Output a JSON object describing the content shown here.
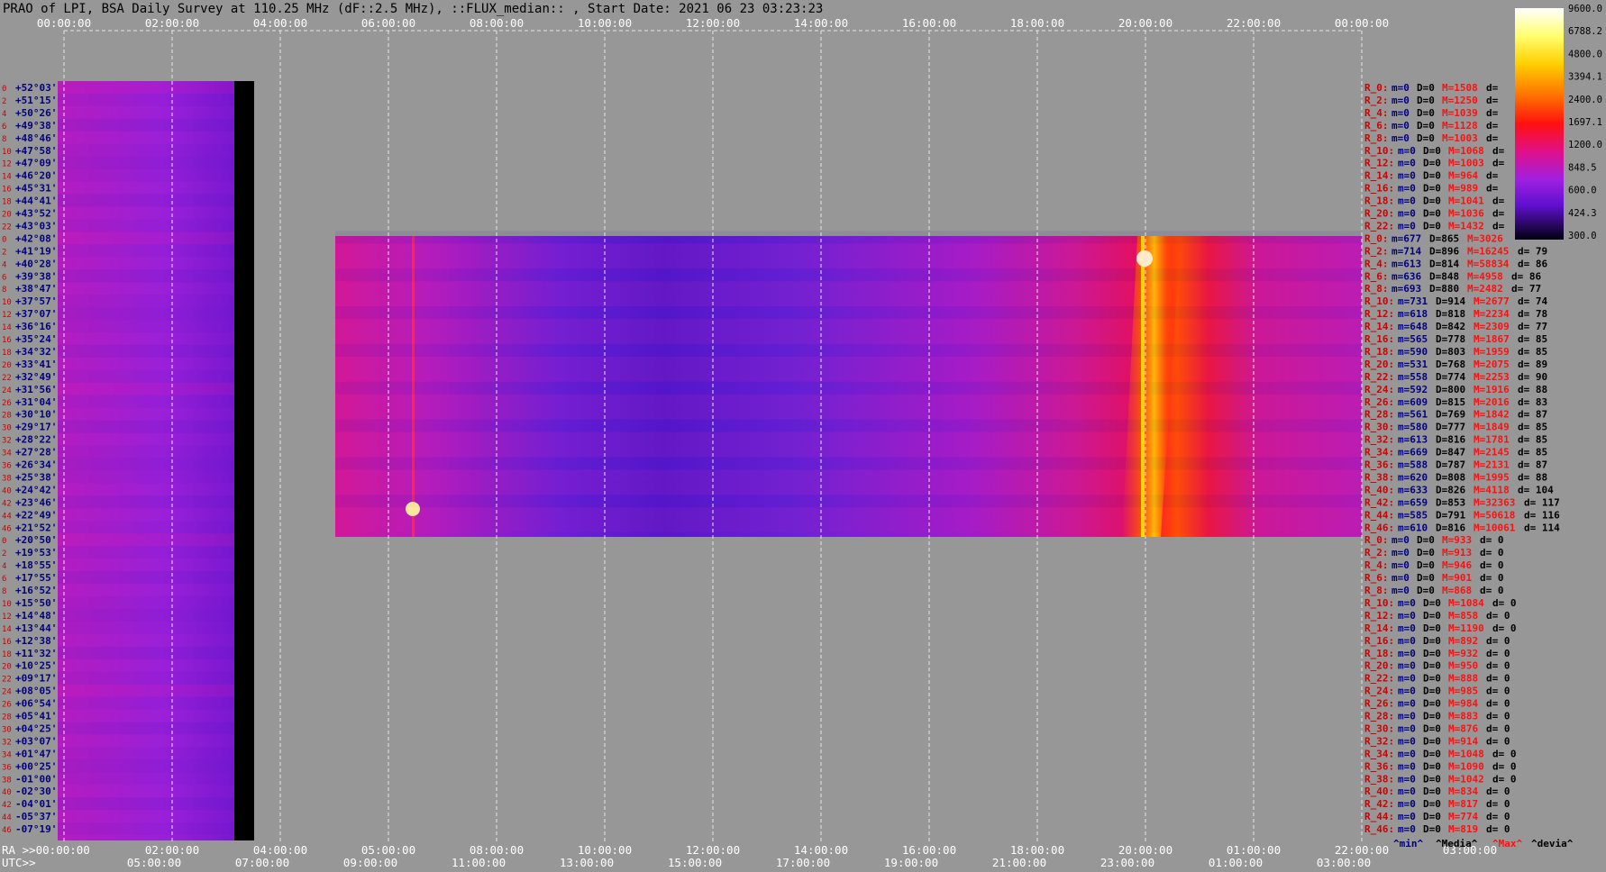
{
  "title": "PRAO of LPI, BSA Daily Survey at 110.25 MHz (dF::2.5 MHz), ::FLUX_median:: , Start Date: 2021 06 23 03:23:23",
  "top_ticks": [
    "00:00:00",
    "02:00:00",
    "04:00:00",
    "06:00:00",
    "08:00:00",
    "10:00:00",
    "12:00:00",
    "14:00:00",
    "16:00:00",
    "18:00:00",
    "20:00:00",
    "22:00:00",
    "00:00:00"
  ],
  "ra_label": "RA >>00:00:00",
  "ra_ticks": [
    "02:00:00",
    "04:00:00",
    "05:00:00",
    "08:00:00",
    "10:00:00",
    "12:00:00",
    "14:00:00",
    "16:00:00",
    "18:00:00",
    "20:00:00",
    "01:00:00",
    "22:00:00",
    "03:00:00"
  ],
  "utc_label": "UTC>>",
  "utc_ticks": [
    "05:00:00",
    "07:00:00",
    "09:00:00",
    "11:00:00",
    "13:00:00",
    "15:00:00",
    "17:00:00",
    "19:00:00",
    "21:00:00",
    "23:00:00",
    "01:00:00",
    "03:00:00"
  ],
  "row_index_labels": [
    "0",
    "2",
    "4",
    "6",
    "8",
    "10",
    "12",
    "14",
    "16",
    "18",
    "20",
    "22",
    "0",
    "2",
    "4",
    "6",
    "8",
    "10",
    "12",
    "14",
    "16",
    "18",
    "20",
    "22",
    "24",
    "26",
    "28",
    "30",
    "32",
    "34",
    "36",
    "38",
    "40",
    "42",
    "44",
    "46",
    "0",
    "2",
    "4",
    "6",
    "8",
    "10",
    "12",
    "14",
    "16",
    "18",
    "20",
    "22",
    "24",
    "26",
    "28",
    "30",
    "32",
    "34",
    "36",
    "38",
    "40",
    "42",
    "44",
    "46"
  ],
  "declinations": [
    "+52°03'",
    "+51°15'",
    "+50°26'",
    "+49°38'",
    "+48°46'",
    "+47°58'",
    "+47°09'",
    "+46°20'",
    "+45°31'",
    "+44°41'",
    "+43°52'",
    "+43°03'",
    "+42°08'",
    "+41°19'",
    "+40°28'",
    "+39°38'",
    "+38°47'",
    "+37°57'",
    "+37°07'",
    "+36°16'",
    "+35°24'",
    "+34°32'",
    "+33°41'",
    "+32°49'",
    "+31°56'",
    "+31°04'",
    "+30°10'",
    "+29°17'",
    "+28°22'",
    "+27°28'",
    "+26°34'",
    "+25°38'",
    "+24°42'",
    "+23°46'",
    "+22°49'",
    "+21°52'",
    "+20°50'",
    "+19°53'",
    "+18°55'",
    "+17°55'",
    "+16°52'",
    "+15°50'",
    "+14°48'",
    "+13°44'",
    "+12°38'",
    "+11°32'",
    "+10°25'",
    "+09°17'",
    "+08°05'",
    "+06°54'",
    "+05°41'",
    "+04°25'",
    "+03°07'",
    "+01°47'",
    "+00°25'",
    "-01°00'",
    "-02°30'",
    "-04°01'",
    "-05°37'",
    "-07°19'"
  ],
  "stats": [
    {
      "r": "R_0:",
      "m": "m=0",
      "D": "D=0",
      "M": "M=1508",
      "d": "d="
    },
    {
      "r": "R_2:",
      "m": "m=0",
      "D": "D=0",
      "M": "M=1250",
      "d": "d="
    },
    {
      "r": "R_4:",
      "m": "m=0",
      "D": "D=0",
      "M": "M=1039",
      "d": "d="
    },
    {
      "r": "R_6:",
      "m": "m=0",
      "D": "D=0",
      "M": "M=1128",
      "d": "d="
    },
    {
      "r": "R_8:",
      "m": "m=0",
      "D": "D=0",
      "M": "M=1003",
      "d": "d="
    },
    {
      "r": "R_10:",
      "m": "m=0",
      "D": "D=0",
      "M": "M=1068",
      "d": "d="
    },
    {
      "r": "R_12:",
      "m": "m=0",
      "D": "D=0",
      "M": "M=1003",
      "d": "d="
    },
    {
      "r": "R_14:",
      "m": "m=0",
      "D": "D=0",
      "M": "M=964",
      "d": "d="
    },
    {
      "r": "R_16:",
      "m": "m=0",
      "D": "D=0",
      "M": "M=989",
      "d": "d="
    },
    {
      "r": "R_18:",
      "m": "m=0",
      "D": "D=0",
      "M": "M=1041",
      "d": "d="
    },
    {
      "r": "R_20:",
      "m": "m=0",
      "D": "D=0",
      "M": "M=1036",
      "d": "d="
    },
    {
      "r": "R_22:",
      "m": "m=0",
      "D": "D=0",
      "M": "M=1432",
      "d": "d="
    },
    {
      "r": "R_0:",
      "m": "m=677",
      "D": "D=865",
      "M": "M=3026",
      "d": ""
    },
    {
      "r": "R_2:",
      "m": "m=714",
      "D": "D=896",
      "M": "M=16245",
      "d": "d= 79"
    },
    {
      "r": "R_4:",
      "m": "m=613",
      "D": "D=814",
      "M": "M=58834",
      "d": "d= 86"
    },
    {
      "r": "R_6:",
      "m": "m=636",
      "D": "D=848",
      "M": "M=4958",
      "d": "d= 86"
    },
    {
      "r": "R_8:",
      "m": "m=693",
      "D": "D=880",
      "M": "M=2482",
      "d": "d= 77"
    },
    {
      "r": "R_10:",
      "m": "m=731",
      "D": "D=914",
      "M": "M=2677",
      "d": "d= 74"
    },
    {
      "r": "R_12:",
      "m": "m=618",
      "D": "D=818",
      "M": "M=2234",
      "d": "d= 78"
    },
    {
      "r": "R_14:",
      "m": "m=648",
      "D": "D=842",
      "M": "M=2309",
      "d": "d= 77"
    },
    {
      "r": "R_16:",
      "m": "m=565",
      "D": "D=778",
      "M": "M=1867",
      "d": "d= 85"
    },
    {
      "r": "R_18:",
      "m": "m=590",
      "D": "D=803",
      "M": "M=1959",
      "d": "d= 85"
    },
    {
      "r": "R_20:",
      "m": "m=531",
      "D": "D=768",
      "M": "M=2075",
      "d": "d= 89"
    },
    {
      "r": "R_22:",
      "m": "m=558",
      "D": "D=774",
      "M": "M=2253",
      "d": "d= 90"
    },
    {
      "r": "R_24:",
      "m": "m=592",
      "D": "D=800",
      "M": "M=1916",
      "d": "d= 88"
    },
    {
      "r": "R_26:",
      "m": "m=609",
      "D": "D=815",
      "M": "M=2016",
      "d": "d= 83"
    },
    {
      "r": "R_28:",
      "m": "m=561",
      "D": "D=769",
      "M": "M=1842",
      "d": "d= 87"
    },
    {
      "r": "R_30:",
      "m": "m=580",
      "D": "D=777",
      "M": "M=1849",
      "d": "d= 85"
    },
    {
      "r": "R_32:",
      "m": "m=613",
      "D": "D=816",
      "M": "M=1781",
      "d": "d= 85"
    },
    {
      "r": "R_34:",
      "m": "m=669",
      "D": "D=847",
      "M": "M=2145",
      "d": "d= 85"
    },
    {
      "r": "R_36:",
      "m": "m=588",
      "D": "D=787",
      "M": "M=2131",
      "d": "d= 87"
    },
    {
      "r": "R_38:",
      "m": "m=620",
      "D": "D=808",
      "M": "M=1995",
      "d": "d= 88"
    },
    {
      "r": "R_40:",
      "m": "m=633",
      "D": "D=826",
      "M": "M=4118",
      "d": "d= 104"
    },
    {
      "r": "R_42:",
      "m": "m=659",
      "D": "D=853",
      "M": "M=32363",
      "d": "d= 117"
    },
    {
      "r": "R_44:",
      "m": "m=585",
      "D": "D=791",
      "M": "M=50618",
      "d": "d= 116"
    },
    {
      "r": "R_46:",
      "m": "m=610",
      "D": "D=816",
      "M": "M=10061",
      "d": "d= 114"
    },
    {
      "r": "R_0:",
      "m": "m=0",
      "D": "D=0",
      "M": "M=933",
      "d": "d= 0"
    },
    {
      "r": "R_2:",
      "m": "m=0",
      "D": "D=0",
      "M": "M=913",
      "d": "d= 0"
    },
    {
      "r": "R_4:",
      "m": "m=0",
      "D": "D=0",
      "M": "M=946",
      "d": "d= 0"
    },
    {
      "r": "R_6:",
      "m": "m=0",
      "D": "D=0",
      "M": "M=901",
      "d": "d= 0"
    },
    {
      "r": "R_8:",
      "m": "m=0",
      "D": "D=0",
      "M": "M=868",
      "d": "d= 0"
    },
    {
      "r": "R_10:",
      "m": "m=0",
      "D": "D=0",
      "M": "M=1084",
      "d": "d= 0"
    },
    {
      "r": "R_12:",
      "m": "m=0",
      "D": "D=0",
      "M": "M=858",
      "d": "d= 0"
    },
    {
      "r": "R_14:",
      "m": "m=0",
      "D": "D=0",
      "M": "M=1190",
      "d": "d= 0"
    },
    {
      "r": "R_16:",
      "m": "m=0",
      "D": "D=0",
      "M": "M=892",
      "d": "d= 0"
    },
    {
      "r": "R_18:",
      "m": "m=0",
      "D": "D=0",
      "M": "M=932",
      "d": "d= 0"
    },
    {
      "r": "R_20:",
      "m": "m=0",
      "D": "D=0",
      "M": "M=950",
      "d": "d= 0"
    },
    {
      "r": "R_22:",
      "m": "m=0",
      "D": "D=0",
      "M": "M=888",
      "d": "d= 0"
    },
    {
      "r": "R_24:",
      "m": "m=0",
      "D": "D=0",
      "M": "M=985",
      "d": "d= 0"
    },
    {
      "r": "R_26:",
      "m": "m=0",
      "D": "D=0",
      "M": "M=984",
      "d": "d= 0"
    },
    {
      "r": "R_28:",
      "m": "m=0",
      "D": "D=0",
      "M": "M=883",
      "d": "d= 0"
    },
    {
      "r": "R_30:",
      "m": "m=0",
      "D": "D=0",
      "M": "M=876",
      "d": "d= 0"
    },
    {
      "r": "R_32:",
      "m": "m=0",
      "D": "D=0",
      "M": "M=914",
      "d": "d= 0"
    },
    {
      "r": "R_34:",
      "m": "m=0",
      "D": "D=0",
      "M": "M=1048",
      "d": "d= 0"
    },
    {
      "r": "R_36:",
      "m": "m=0",
      "D": "D=0",
      "M": "M=1090",
      "d": "d= 0"
    },
    {
      "r": "R_38:",
      "m": "m=0",
      "D": "D=0",
      "M": "M=1042",
      "d": "d= 0"
    },
    {
      "r": "R_40:",
      "m": "m=0",
      "D": "D=0",
      "M": "M=834",
      "d": "d= 0"
    },
    {
      "r": "R_42:",
      "m": "m=0",
      "D": "D=0",
      "M": "M=817",
      "d": "d= 0"
    },
    {
      "r": "R_44:",
      "m": "m=0",
      "D": "D=0",
      "M": "M=774",
      "d": "d= 0"
    },
    {
      "r": "R_46:",
      "m": "m=0",
      "D": "D=0",
      "M": "M=819",
      "d": "d= 0"
    }
  ],
  "stats_legend": {
    "min": "^min^",
    "media": "^Media^",
    "max": "^Max^",
    "devia": "^devia^"
  },
  "colors": {
    "background": "#979797",
    "index_red": "#d00000",
    "dec_blue": "#000080",
    "max_red": "#ff1010"
  },
  "chart_data": {
    "type": "heatmap",
    "title": "PRAO of LPI, BSA Daily Survey at 110.25 MHz (dF::2.5 MHz), ::FLUX_median:: , Start Date: 2021 06 23 03:23:23",
    "x_axis_top": [
      "00:00:00",
      "02:00:00",
      "04:00:00",
      "06:00:00",
      "08:00:00",
      "10:00:00",
      "12:00:00",
      "14:00:00",
      "16:00:00",
      "18:00:00",
      "20:00:00",
      "22:00:00",
      "00:00:00"
    ],
    "x_axis_bottom_ra": [
      "00:00:00",
      "02:00:00",
      "04:00:00",
      "05:00:00",
      "08:00:00",
      "10:00:00",
      "12:00:00",
      "14:00:00",
      "16:00:00",
      "18:00:00",
      "20:00:00",
      "01:00:00",
      "22:00:00",
      "03:00:00"
    ],
    "x_axis_bottom_utc": [
      "05:00:00",
      "07:00:00",
      "09:00:00",
      "11:00:00",
      "13:00:00",
      "15:00:00",
      "17:00:00",
      "19:00:00",
      "21:00:00",
      "23:00:00",
      "01:00:00",
      "03:00:00"
    ],
    "colorbar": {
      "ticks": [
        9600.0,
        6788.2,
        4800.0,
        3394.1,
        2400.0,
        1697.1,
        1200.0,
        848.5,
        600.0,
        424.3,
        300.0
      ],
      "scale": "log"
    },
    "panels": [
      {
        "rows": "R_0 to R_22 (upper block)",
        "ra_start_hours": 0.0,
        "ra_end_hours": 3.2,
        "typical_level": 850
      },
      {
        "rows": "R_0 to R_46 (middle block)",
        "ra_start_hours": 5.0,
        "ra_end_hours": 24.0,
        "typical_level": 800,
        "bright_sources_ra_hours": [
          6.4,
          20.0
        ]
      },
      {
        "rows": "R_0 to R_46 (lower block)",
        "ra_start_hours": 0.0,
        "ra_end_hours": 3.2,
        "typical_level": 850
      }
    ],
    "grid": true
  }
}
